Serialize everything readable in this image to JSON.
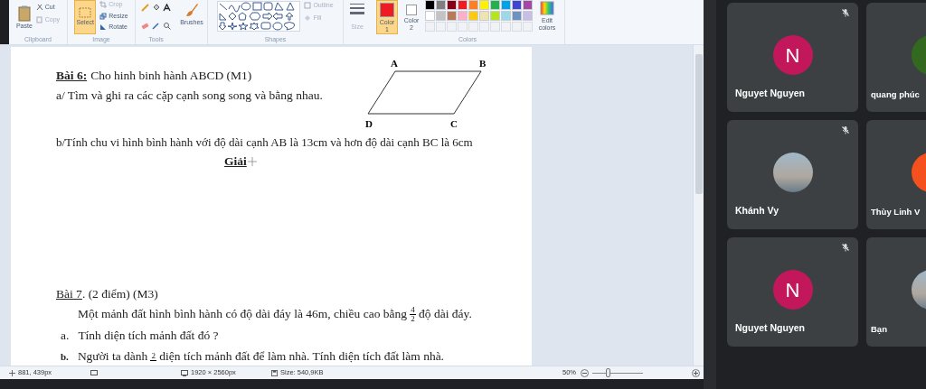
{
  "ribbon": {
    "clipboard": {
      "label": "Clipboard",
      "paste": "Paste",
      "cut": "Cut",
      "copy": "Copy"
    },
    "image": {
      "label": "Image",
      "select": {
        "label": "Select",
        "selected": true
      },
      "crop": "Crop",
      "resize": "Resize",
      "rotate": "Rotate"
    },
    "tools": {
      "label": "Tools"
    },
    "brushes": {
      "label": "Brushes"
    },
    "shapes": {
      "label": "Shapes",
      "outline": "Outline",
      "fill": "Fill"
    },
    "size": {
      "label": "Size"
    },
    "colors": {
      "label": "Colors",
      "color_slots": [
        {
          "label": "Color",
          "number": "1",
          "color": "#ed1c24",
          "selected": true
        },
        {
          "label": "Color",
          "number": "2",
          "color": "#ffffff",
          "selected": false
        }
      ],
      "palette": [
        {
          "color": "#000000"
        },
        {
          "color": "#7f7f7f"
        },
        {
          "color": "#880015"
        },
        {
          "color": "#ed1c24"
        },
        {
          "color": "#ff7f27"
        },
        {
          "color": "#fff200"
        },
        {
          "color": "#22b14c"
        },
        {
          "color": "#00a2e8"
        },
        {
          "color": "#3f48cc"
        },
        {
          "color": "#a349a4"
        },
        {
          "color": "#ffffff"
        },
        {
          "color": "#c3c3c3"
        },
        {
          "color": "#b97a57"
        },
        {
          "color": "#ffaec9"
        },
        {
          "color": "#ffc90e"
        },
        {
          "color": "#efe4b0"
        },
        {
          "color": "#b5e61d"
        },
        {
          "color": "#99d9ea"
        },
        {
          "color": "#7092be"
        },
        {
          "color": "#c8bfe7"
        }
      ],
      "edit_colors": "Edit colors"
    }
  },
  "document": {
    "exercise_6": {
      "label": "Bài 6:",
      "title": "Cho hinh binh hành ABCD (M1)",
      "part_a": "a/ Tìm và ghi ra các cặp cạnh song song và bằng nhau.",
      "figure_labels": [
        "A",
        "B",
        "D",
        "C"
      ],
      "part_b": "b/Tính chu vi hình bình hành với độ dài cạnh AB là 13cm và hơn độ dài cạnh BC là 6cm",
      "solution": "Giải"
    },
    "exercise_7": {
      "label": "Bài 7",
      "title": ". (2 điểm) (M3)",
      "intro_before": "Một mảnh đất hình bình hành có độ dài đáy là 46m, chiều cao bằng",
      "fraction": {
        "numerator": "4",
        "denominator": "2"
      },
      "intro_after": "độ dài đáy.",
      "part_a": {
        "marker": "a.",
        "text": "Tính diện tích mảnh đất đó ?"
      },
      "part_b": {
        "marker": "b.",
        "before": "Người ta dành",
        "numerator": "2",
        "after": "diện tích mảnh đất để làm nhà. Tính diện tích đất làm nhà."
      }
    }
  },
  "status_bar": {
    "cursor": "881, 439px",
    "dimensions": "1920 × 2560px",
    "size": "Size: 540,9KB",
    "zoom": "50%",
    "zoom_slider": {
      "level": 0.3
    }
  },
  "participants": [
    {
      "name": "Nguyet Nguyen",
      "avatar": {
        "kind": "letter",
        "letter": "N",
        "color": "#c2185b"
      },
      "muted": true
    },
    {
      "name": "quang phúc",
      "avatar": {
        "kind": "letter",
        "color": "#33691e"
      },
      "muted": false
    },
    {
      "name": "Khánh Vy",
      "avatar": {
        "kind": "photo"
      },
      "muted": true
    },
    {
      "name": "Thùy Linh V",
      "avatar": {
        "kind": "letter",
        "color": "#f4511e"
      },
      "muted": false
    },
    {
      "name": "Nguyet Nguyen",
      "avatar": {
        "kind": "letter",
        "letter": "N",
        "color": "#c2185b"
      },
      "muted": true
    },
    {
      "name": "Bạn",
      "avatar": {
        "kind": "photo"
      },
      "muted": false
    }
  ]
}
